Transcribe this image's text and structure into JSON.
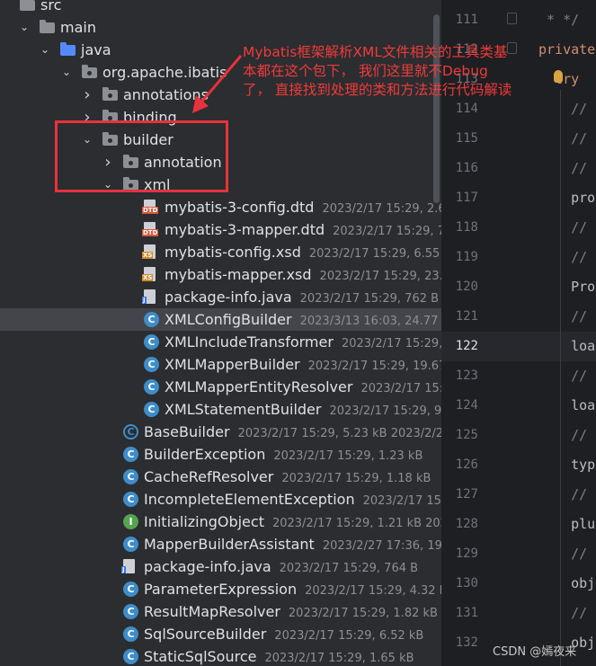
{
  "tree": {
    "nodes": [
      {
        "label": "src",
        "meta": "",
        "arrow": "",
        "icon": "folder"
      },
      {
        "label": "main",
        "meta": "",
        "arrow": "down",
        "icon": "folder"
      },
      {
        "label": "java",
        "meta": "",
        "arrow": "down",
        "icon": "folder-blue"
      },
      {
        "label": "org.apache.ibatis",
        "meta": "",
        "arrow": "down",
        "icon": "package"
      },
      {
        "label": "annotations",
        "meta": "",
        "arrow": "right",
        "icon": "package"
      },
      {
        "label": "binding",
        "meta": "",
        "arrow": "right",
        "icon": "package"
      },
      {
        "label": "builder",
        "meta": "",
        "arrow": "down",
        "icon": "package"
      },
      {
        "label": "annotation",
        "meta": "",
        "arrow": "right",
        "icon": "package"
      },
      {
        "label": "xml",
        "meta": "",
        "arrow": "down",
        "icon": "package"
      },
      {
        "label": "mybatis-3-config.dtd",
        "meta": "2023/2/17 15:29, 2.6",
        "arrow": "",
        "icon": "dtd"
      },
      {
        "label": "mybatis-3-mapper.dtd",
        "meta": "2023/2/17 15:29, 7.",
        "arrow": "",
        "icon": "dtd"
      },
      {
        "label": "mybatis-config.xsd",
        "meta": "2023/2/17 15:29, 6.55 k",
        "arrow": "",
        "icon": "xsd"
      },
      {
        "label": "mybatis-mapper.xsd",
        "meta": "2023/2/17 15:29, 23.9",
        "arrow": "",
        "icon": "xsd"
      },
      {
        "label": "package-info.java",
        "meta": "2023/2/17 15:29, 762 B",
        "arrow": "",
        "icon": "java-file"
      },
      {
        "label": "XMLConfigBuilder",
        "meta": "2023/3/13 16:03, 24.77 k",
        "arrow": "",
        "icon": "class"
      },
      {
        "label": "XMLIncludeTransformer",
        "meta": "2023/2/17 15:29,",
        "arrow": "",
        "icon": "class"
      },
      {
        "label": "XMLMapperBuilder",
        "meta": "2023/2/17 15:29, 19.67",
        "arrow": "",
        "icon": "class"
      },
      {
        "label": "XMLMapperEntityResolver",
        "meta": "2023/2/17 15:2",
        "arrow": "",
        "icon": "class"
      },
      {
        "label": "XMLStatementBuilder",
        "meta": "2023/2/17 15:29, 9.5",
        "arrow": "",
        "icon": "class"
      },
      {
        "label": "BaseBuilder",
        "meta": "2023/2/17 15:29, 5.23 kB 2023/2/27",
        "arrow": "",
        "icon": "abstract"
      },
      {
        "label": "BuilderException",
        "meta": "2023/2/17 15:29, 1.23 kB",
        "arrow": "",
        "icon": "class"
      },
      {
        "label": "CacheRefResolver",
        "meta": "2023/2/17 15:29, 1.18 kB",
        "arrow": "",
        "icon": "class"
      },
      {
        "label": "IncompleteElementException",
        "meta": "2023/2/17 15:2",
        "arrow": "",
        "icon": "class"
      },
      {
        "label": "InitializingObject",
        "meta": "2023/2/17 15:29, 1.21 kB 202",
        "arrow": "",
        "icon": "interface"
      },
      {
        "label": "MapperBuilderAssistant",
        "meta": "2023/2/27 17:36, 19.6",
        "arrow": "",
        "icon": "class"
      },
      {
        "label": "package-info.java",
        "meta": "2023/2/17 15:29, 764 B",
        "arrow": "",
        "icon": "java-file"
      },
      {
        "label": "ParameterExpression",
        "meta": "2023/2/17 15:29, 4.32 kB",
        "arrow": "",
        "icon": "class"
      },
      {
        "label": "ResultMapResolver",
        "meta": "2023/2/17 15:29, 1.82 kB",
        "arrow": "",
        "icon": "class"
      },
      {
        "label": "SqlSourceBuilder",
        "meta": "2023/2/17 15:29, 6.52 kB",
        "arrow": "",
        "icon": "class"
      },
      {
        "label": "StaticSqlSource",
        "meta": "2023/2/17 15:29, 1.65 kB",
        "arrow": "",
        "icon": "class"
      }
    ]
  },
  "editor": {
    "current_line": "122",
    "lines": [
      {
        "num": "111",
        "code": " * */",
        "cls": "comment"
      },
      {
        "num": "112",
        "code": "private",
        "cls": "kw"
      },
      {
        "num": "113",
        "code": "  try",
        "cls": "kw"
      },
      {
        "num": "114",
        "code": "    //",
        "cls": "comment"
      },
      {
        "num": "115",
        "code": "    //",
        "cls": "comment"
      },
      {
        "num": "116",
        "code": "    //",
        "cls": "comment"
      },
      {
        "num": "117",
        "code": "    pro",
        "cls": "plain"
      },
      {
        "num": "118",
        "code": "    //",
        "cls": "comment"
      },
      {
        "num": "119",
        "code": "    //",
        "cls": "comment"
      },
      {
        "num": "120",
        "code": "    Pro",
        "cls": "plain"
      },
      {
        "num": "121",
        "code": "    //",
        "cls": "comment"
      },
      {
        "num": "122",
        "code": "    loa",
        "cls": "plain"
      },
      {
        "num": "123",
        "code": "    //",
        "cls": "comment"
      },
      {
        "num": "124",
        "code": "    loa",
        "cls": "plain"
      },
      {
        "num": "125",
        "code": "    //",
        "cls": "comment"
      },
      {
        "num": "126",
        "code": "    typ",
        "cls": "plain"
      },
      {
        "num": "127",
        "code": "    //",
        "cls": "comment"
      },
      {
        "num": "128",
        "code": "    plu",
        "cls": "plain"
      },
      {
        "num": "129",
        "code": "    //",
        "cls": "comment"
      },
      {
        "num": "130",
        "code": "    obj",
        "cls": "plain"
      },
      {
        "num": "131",
        "code": "    //",
        "cls": "comment"
      },
      {
        "num": "132",
        "code": "    obj",
        "cls": "plain"
      }
    ]
  },
  "annotation": {
    "text": "Mybatis框架解析XML文件相关的工具类基本都在这个包下， 我们这里就不Debug了， 直接找到处理的类和方法进行代码解读"
  },
  "watermark": "CSDN @嫣夜来",
  "colors": {
    "annotation": "#f03a3a",
    "selection": "#43454a",
    "class_icon": "#3e8dc9",
    "interface_icon": "#56a350"
  }
}
